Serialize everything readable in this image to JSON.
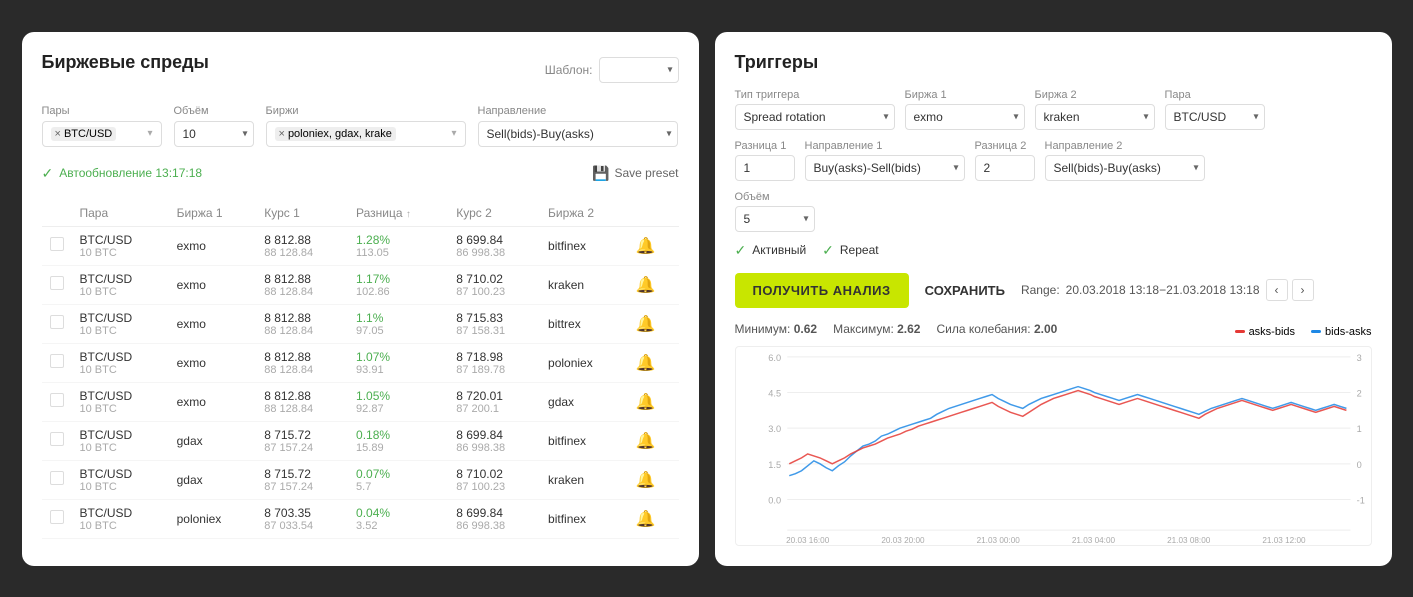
{
  "left_panel": {
    "title": "Биржевые спреды",
    "shablom_label": "Шаблон:",
    "filters": {
      "pairs_label": "Пары",
      "pairs_value": "BTC/USD",
      "volume_label": "Объём",
      "volume_value": "10",
      "exchanges_label": "Биржи",
      "exchanges_value": "poloniex, gdax, krake",
      "direction_label": "Направление",
      "direction_value": "Sell(bids)-Buy(asks)"
    },
    "status_text": "Автообновление 13:17:18",
    "save_preset_label": "Save preset",
    "table": {
      "headers": [
        "",
        "Пара",
        "Биржа 1",
        "Курс 1",
        "Разница ↑",
        "Курс 2",
        "Биржа 2",
        ""
      ],
      "rows": [
        {
          "pair": "BTC/USD",
          "sub": "10 BTC",
          "exchange1": "exmo",
          "price1": "8 812.88",
          "price1sub": "88 128.84",
          "diff": "1.28%",
          "diffsub": "113.05",
          "price2": "8 699.84",
          "price2sub": "86 998.38",
          "exchange2": "bitfinex"
        },
        {
          "pair": "BTC/USD",
          "sub": "10 BTC",
          "exchange1": "exmo",
          "price1": "8 812.88",
          "price1sub": "88 128.84",
          "diff": "1.17%",
          "diffsub": "102.86",
          "price2": "8 710.02",
          "price2sub": "87 100.23",
          "exchange2": "kraken"
        },
        {
          "pair": "BTC/USD",
          "sub": "10 BTC",
          "exchange1": "exmo",
          "price1": "8 812.88",
          "price1sub": "88 128.84",
          "diff": "1.1%",
          "diffsub": "97.05",
          "price2": "8 715.83",
          "price2sub": "87 158.31",
          "exchange2": "bittrex"
        },
        {
          "pair": "BTC/USD",
          "sub": "10 BTC",
          "exchange1": "exmo",
          "price1": "8 812.88",
          "price1sub": "88 128.84",
          "diff": "1.07%",
          "diffsub": "93.91",
          "price2": "8 718.98",
          "price2sub": "87 189.78",
          "exchange2": "poloniex"
        },
        {
          "pair": "BTC/USD",
          "sub": "10 BTC",
          "exchange1": "exmo",
          "price1": "8 812.88",
          "price1sub": "88 128.84",
          "diff": "1.05%",
          "diffsub": "92.87",
          "price2": "8 720.01",
          "price2sub": "87 200.1",
          "exchange2": "gdax"
        },
        {
          "pair": "BTC/USD",
          "sub": "10 BTC",
          "exchange1": "gdax",
          "price1": "8 715.72",
          "price1sub": "87 157.24",
          "diff": "0.18%",
          "diffsub": "15.89",
          "price2": "8 699.84",
          "price2sub": "86 998.38",
          "exchange2": "bitfinex"
        },
        {
          "pair": "BTC/USD",
          "sub": "10 BTC",
          "exchange1": "gdax",
          "price1": "8 715.72",
          "price1sub": "87 157.24",
          "diff": "0.07%",
          "diffsub": "5.7",
          "price2": "8 710.02",
          "price2sub": "87 100.23",
          "exchange2": "kraken"
        },
        {
          "pair": "BTC/USD",
          "sub": "10 BTC",
          "exchange1": "poloniex",
          "price1": "8 703.35",
          "price1sub": "87 033.54",
          "diff": "0.04%",
          "diffsub": "3.52",
          "price2": "8 699.84",
          "price2sub": "86 998.38",
          "exchange2": "bitfinex"
        }
      ]
    }
  },
  "right_panel": {
    "title": "Триггеры",
    "trigger_type_label": "Тип триггера",
    "trigger_type_value": "Spread rotation",
    "exchange1_label": "Биржа 1",
    "exchange1_value": "exmo",
    "exchange2_label": "Биржа 2",
    "exchange2_value": "kraken",
    "pair_label": "Пара",
    "pair_value": "BTC/USD",
    "diff1_label": "Разница 1",
    "diff1_value": "1",
    "direction1_label": "Направление 1",
    "direction1_value": "Buy(asks)-Sell(bids)",
    "diff2_label": "Разница 2",
    "diff2_value": "2",
    "direction2_label": "Направление 2",
    "direction2_value": "Sell(bids)-Buy(asks)",
    "volume_label": "Объём",
    "volume_value": "5",
    "active_label": "Активный",
    "repeat_label": "Repeat",
    "get_analysis_label": "ПОЛУЧИТЬ АНАЛИЗ",
    "save_label": "СОХРАНИТЬ",
    "range_label": "Range:",
    "range_value": "20.03.2018 13:18−21.03.2018 13:18",
    "chart": {
      "min_label": "Минимум:",
      "min_value": "0.62",
      "max_label": "Максимум:",
      "max_value": "2.62",
      "oscillation_label": "Сила колебания:",
      "oscillation_value": "2.00",
      "legend_asks_bids": "asks-bids",
      "legend_bids_asks": "bids-asks",
      "y_labels": [
        "6.0",
        "4.5",
        "3.0",
        "1.5",
        "0.0"
      ],
      "y_labels_right": [
        "3",
        "2",
        "1",
        "0",
        "-1"
      ],
      "x_labels": [
        "20.03 16:00",
        "20.03 20:00",
        "21.03 00:00",
        "21.03 04:00",
        "21.03 08:00",
        "21.03 12:00"
      ]
    }
  }
}
